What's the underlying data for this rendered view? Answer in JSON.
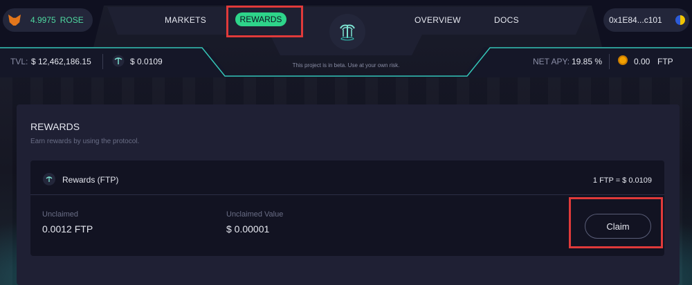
{
  "header": {
    "balance": {
      "value": "4.9975",
      "unit": "ROSE"
    },
    "nav": [
      {
        "label": "MARKETS"
      },
      {
        "label": "REWARDS",
        "active": true
      },
      {
        "label": "OVERVIEW"
      },
      {
        "label": "DOCS"
      }
    ],
    "wallet": {
      "address": "0x1E84...c101"
    },
    "accent_color": "#2ed48a"
  },
  "stats": {
    "tvl_label": "TVL:",
    "tvl_value": "$ 12,462,186.15",
    "ftp_price": "$ 0.0109",
    "beta_notice": "This project is in beta. Use at your own risk.",
    "net_apy_label": "NET APY:",
    "net_apy_value": "19.85 %",
    "ftp_balance": "0.00",
    "ftp_balance_unit": "FTP"
  },
  "rewards": {
    "title": "REWARDS",
    "subtitle": "Earn rewards by using the protocol.",
    "panel_title": "Rewards (FTP)",
    "rate": "1 FTP  =  $ 0.0109",
    "unclaimed_label": "Unclaimed",
    "unclaimed_value": "0.0012 FTP",
    "unclaimed_value_label": "Unclaimed Value",
    "unclaimed_value_amount": "$ 0.00001",
    "claim_label": "Claim"
  }
}
